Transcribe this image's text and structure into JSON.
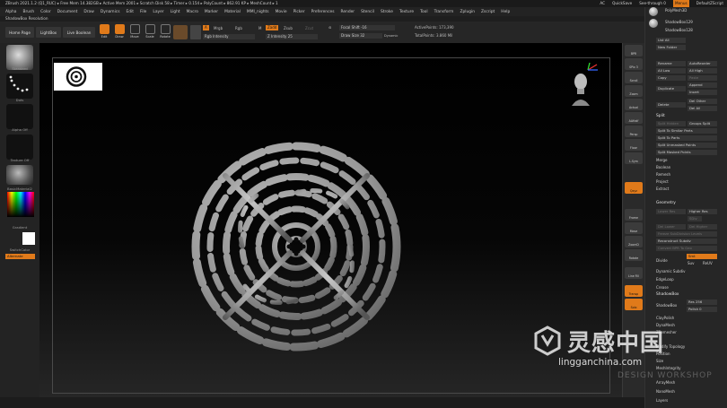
{
  "titlebar": {
    "text": "ZBrush 2021.1.2 (Q1_RUC)  ▸ Free Mem 14.382GB ▸ Active Mem 2001 ▸ Scratch Disk 58 ▸ Timer ▸ 0.154 ▸ PolyCount ▸ 862.91 KP ▸ MeshCount ▸ 1",
    "ac": "AC",
    "quicksave": "QuickSave",
    "see_through": "See-through 0",
    "menus_btn": "Menus",
    "default_script": "DefaultZScript"
  },
  "menubar": [
    "Alpha",
    "Brush",
    "Color",
    "Document",
    "Draw",
    "Dynamics",
    "Edit",
    "File",
    "Layer",
    "Light",
    "Macro",
    "Marker",
    "Material",
    "MMI_nights",
    "Movie",
    "Picker",
    "Preferences",
    "Render",
    "Stencil",
    "Stroke",
    "Texture",
    "Tool",
    "Transform",
    "Zplugin",
    "Zscript",
    "Help"
  ],
  "subtitle": "ShadowBox Resolution",
  "toolbar": {
    "home_page": "Home Page",
    "lightbox": "LightBox",
    "live_boolean": "Live Boolean",
    "edit": "Edit",
    "draw": "Draw",
    "move": "Move",
    "scale": "Scale",
    "rotate": "Rotate",
    "a_label": "A",
    "mrgb": "Mrgb",
    "rgb": "Rgb",
    "rgb_intensity": "Rgb Intensity",
    "m_label": "M",
    "zadd": "Zadd",
    "zsub": "Zsub",
    "zcut": "Zcut",
    "z_intensity": "Z Intensity 25",
    "focal_shift": "Focal Shift -16",
    "draw_size": "Draw Size 32",
    "dynamic": "Dynamic",
    "active_points": "ActivePoints: 173,390",
    "total_points": "TotalPoints: 3.860 Mil"
  },
  "leftshelf": {
    "brush": "Standard",
    "stroke": "Dots",
    "alpha": "Alpha Off",
    "texture": "Texture Off",
    "material": "BasicMaterial2",
    "gradient": "Gradient",
    "switch_color": "SwitchColor",
    "alternate": "Alternate"
  },
  "rightshelf": [
    "BPR",
    "SPix 3",
    "Scroll",
    "Zoom",
    "Actual",
    "AAHalf",
    "Persp",
    "Floor",
    "L.Sym",
    "Qxyz",
    "Frame",
    "Move",
    "ZoomD",
    "Rotate",
    "Line Fill",
    "Transp",
    "Solo"
  ],
  "rightpanel": {
    "tools_top": [
      "PolyMesh3D",
      "ShadowBox129",
      "ShadowBox128"
    ],
    "lists_all": "List All",
    "new_folder": "New Folder",
    "rename": "Rename",
    "auto_reorder": "AutoReorder",
    "all_low": "All Low",
    "all_high": "All High",
    "copy": "Copy",
    "paste": "Paste",
    "duplicate": "Duplicate",
    "append": "Append",
    "insert": "Insert",
    "delete": "Delete",
    "del_other": "Del Other",
    "del_all": "Del All",
    "split_header": "Split",
    "split_hidden": "Split Hidden",
    "groups_split": "Groups Split",
    "split_similar": "Split To Similar Parts",
    "split_parts": "Split To Parts",
    "split_unmasked": "Split Unmasked Points",
    "split_masked": "Split Masked Points",
    "merge": "Merge",
    "boolean": "Boolean",
    "remesh": "Remesh",
    "project": "Project",
    "extract": "Extract",
    "geometry_header": "Geometry",
    "lower_res": "Lower Res",
    "higher_res": "Higher Res",
    "sdiv": "SDiv",
    "del_lower": "Del Lower",
    "del_higher": "Del Higher",
    "freeze_subdiv": "Freeze SubDivision Levels",
    "reconstruct_subdiv": "Reconstruct Subdiv",
    "convert_bpr": "Convert BPR To Geo",
    "divide": "Divide",
    "smt": "Smt",
    "suv": "Suv",
    "rsuv": "ReUV",
    "dynamic_subdiv": "Dynamic Subdiv",
    "edgeloop": "EdgeLoop",
    "crease": "Crease",
    "shadowbox_header": "ShadowBox",
    "shadowbox": "ShadowBox",
    "res": "Res 256",
    "polish": "Polish 0",
    "claypolish": "ClayPolish",
    "dynamesh": "DynaMesh",
    "zremesher": "ZRemesher",
    "modify_topology": "Modify Topology",
    "position": "Position",
    "size": "Size",
    "meshintegrity": "MeshIntegrity",
    "arraymesh": "ArrayMesh",
    "nanomesh": "NanoMesh",
    "layers": "Layers"
  },
  "watermark": {
    "brand_cn": "灵感中国",
    "url": "lingganchina.com",
    "sub": "DESIGN WORKSHOP"
  },
  "colors": {
    "accent": "#e07a1a",
    "panel": "#262626",
    "viewport": "#000000",
    "mesh": "#9a9a9a"
  }
}
